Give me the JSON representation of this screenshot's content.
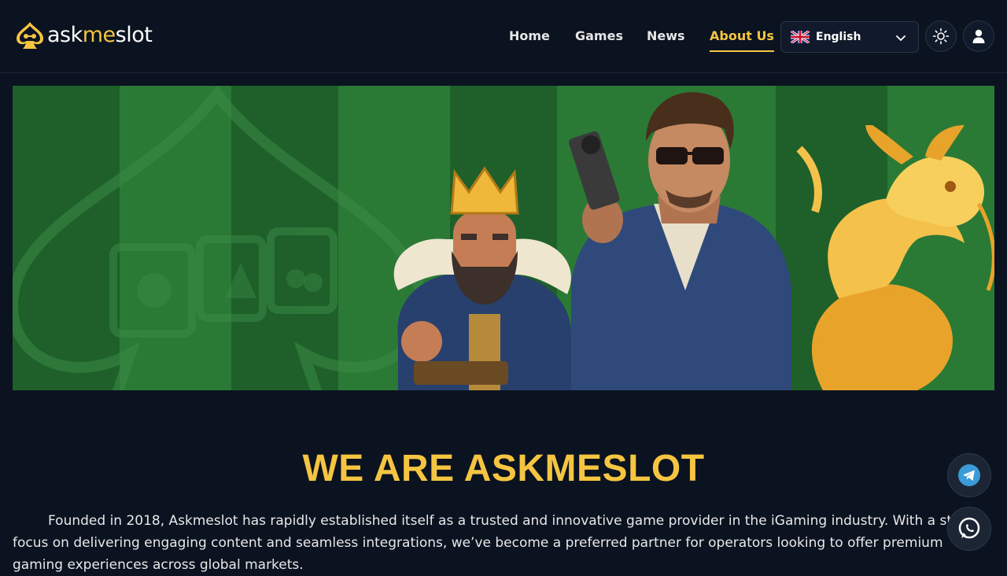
{
  "brand": {
    "name_part1": "ask",
    "name_part2": "me",
    "name_part3": "slot"
  },
  "nav": {
    "items": [
      {
        "label": "Home",
        "active": false
      },
      {
        "label": "Games",
        "active": false
      },
      {
        "label": "News",
        "active": false
      },
      {
        "label": "About Us",
        "active": true
      }
    ]
  },
  "language": {
    "selected": "English",
    "flag_icon": "uk-flag-icon"
  },
  "icons": {
    "theme_toggle": "sun-icon",
    "account": "user-icon",
    "telegram": "telegram-icon",
    "whatsapp": "whatsapp-icon"
  },
  "banner": {
    "characters": [
      "king",
      "gunman",
      "golden-dragon"
    ]
  },
  "main": {
    "heading": "WE ARE ASKMESLOT",
    "paragraph": "Founded in 2018, Askmeslot has rapidly established itself as a trusted and innovative game provider in the iGaming industry. With a strong focus on delivering engaging content and seamless integrations, we’ve become a preferred partner for operators looking to offer premium gaming experiences across global markets."
  },
  "colors": {
    "background": "#0b1320",
    "accent": "#f5c542",
    "banner_green": "#1d5d2a"
  }
}
